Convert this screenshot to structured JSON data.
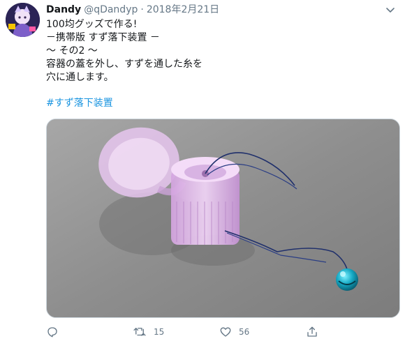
{
  "tweet": {
    "author": {
      "name": "Dandy",
      "handle": "@qDandyp",
      "separator": "·",
      "date": "2018年2月21日",
      "avatar_icon": "profile-avatar"
    },
    "menu_icon": "chevron-down-icon",
    "text_lines": [
      "100均グッズで作る!",
      "－携帯版 すず落下装置 －",
      "～ その2 ～",
      "容器の蓋を外し、すずを通した糸を",
      "穴に通します。"
    ],
    "hashtag": "#すず落下装置",
    "media": {
      "kind": "photo",
      "icon": "photo-bottle-cap-with-bell"
    },
    "actions": {
      "reply": {
        "icon": "reply-icon",
        "count": ""
      },
      "retweet": {
        "icon": "retweet-icon",
        "count": "15"
      },
      "like": {
        "icon": "heart-icon",
        "count": "56"
      },
      "share": {
        "icon": "share-icon",
        "count": ""
      }
    }
  },
  "colors": {
    "text": "#14171a",
    "muted": "#657786",
    "link": "#1b95e0"
  }
}
